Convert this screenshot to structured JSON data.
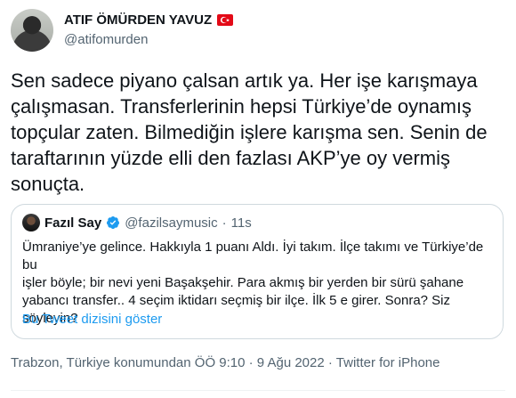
{
  "author": {
    "display_name": "ATIF ÖMÜRDEN YAVUZ",
    "handle": "@atifomurden",
    "flag_icon": "turkey-flag"
  },
  "tweet": {
    "text": "Sen sadece piyano çalsan artık ya. Her işe karışmaya\nçalışmasan. Transferlerinin hepsi Türkiye’de oynamış\ntopçular zaten. Bilmediğin işlere karışma sen. Senin de\ntaraftarının yüzde elli den fazlası AKP’ye oy vermiş\nsonuçta."
  },
  "quote": {
    "name": "Fazıl Say",
    "handle": "@fazilsaymusic",
    "separator": "·",
    "time": "11s",
    "text": "Ümraniye’ye gelince. Hakkıyla 1 puanı Aldı. İyi takım. İlçe takımı ve Türkiye’de bu\nişler böyle; bir nevi yeni Başakşehir. Para akmış bir yerden bir sürü şahane\nyabancı transfer.. 4 seçim iktidarı seçmiş bir ilçe. İlk 5 e girer. Sonra? Siz\nsöyleyin?",
    "thread_link": "Bu Tweet dizisini göster"
  },
  "meta": {
    "text": "Trabzon, Türkiye konumundan ÖÖ 9:10 · 9 Ağu 2022 · Twitter for iPhone"
  },
  "colors": {
    "link": "#1d9bf0",
    "secondary": "#536471",
    "border": "#cfd9de"
  }
}
